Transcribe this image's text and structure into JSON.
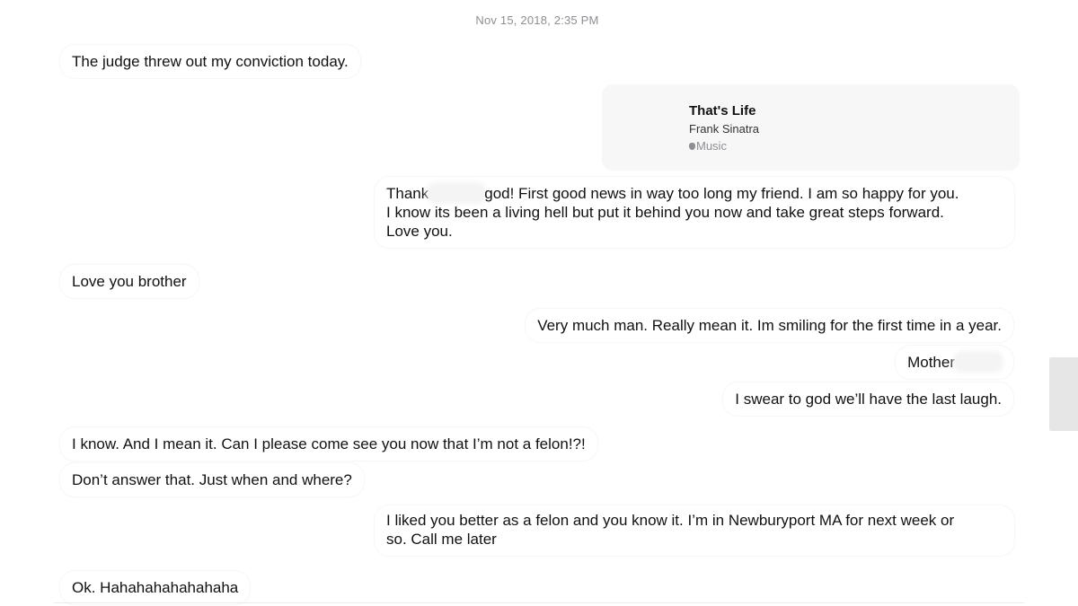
{
  "conversation": {
    "timestamp": "Nov 15, 2018, 2:35 PM",
    "messages": [
      {
        "side": "in",
        "text": "The judge threw out my conviction today."
      },
      {
        "side": "out",
        "type": "music",
        "song_title": "That's Life",
        "artist": "Frank Sinatra",
        "source": "Music",
        "source_icon": "apple-logo-icon"
      },
      {
        "side": "out",
        "text_part1": "Thank",
        "redacted": true,
        "text_part2": "god! First good news in way too long my friend. I am so happy for you.",
        "line2": "I know its been a living hell but put it behind you now and take great steps forward.",
        "line3": "Love you."
      },
      {
        "side": "in",
        "text": "Love you brother"
      },
      {
        "side": "out",
        "text": "Very much man. Really mean it. Im smiling for the first time in a year."
      },
      {
        "side": "out",
        "text": "Mother",
        "redacted": true
      },
      {
        "side": "out",
        "text": "I swear to god we’ll have the last laugh."
      },
      {
        "side": "in",
        "text": "I know.  And I mean it.  Can I please come see you now that I’m not a felon!?!"
      },
      {
        "side": "in",
        "text": "Don’t answer that. Just when and where?"
      },
      {
        "side": "out",
        "line1": "I liked you better as a felon and you know it.  I’m in Newburyport MA for next week or",
        "line2": "so. Call me later"
      },
      {
        "side": "in",
        "text": "Ok. Hahahahahahahaha"
      }
    ]
  },
  "colors": {
    "background": "#ffffff",
    "timestamp": "#8e8e93",
    "text": "#111111",
    "card": "#f7f7f7"
  }
}
